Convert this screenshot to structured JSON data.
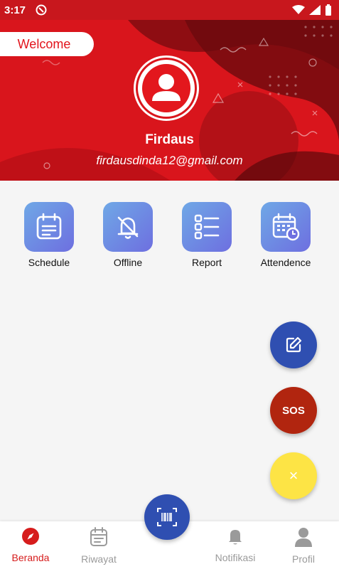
{
  "status": {
    "time": "3:17"
  },
  "profile": {
    "welcome": "Welcome",
    "name": "Firdaus",
    "email": "firdausdinda12@gmail.com"
  },
  "menu": [
    {
      "label": "Schedule",
      "icon": "schedule-icon"
    },
    {
      "label": "Offline",
      "icon": "bell-off-icon"
    },
    {
      "label": "Report",
      "icon": "checklist-icon"
    },
    {
      "label": "Attendence",
      "icon": "calendar-clock-icon"
    }
  ],
  "fabs": {
    "sos_label": "SOS",
    "close_symbol": "×"
  },
  "bottom_nav": [
    {
      "label": "Beranda",
      "icon": "compass-icon",
      "active": true
    },
    {
      "label": "Riwayat",
      "icon": "calendar-icon",
      "active": false
    },
    {
      "label": "Notifikasi",
      "icon": "bell-icon",
      "active": false
    },
    {
      "label": "Profil",
      "icon": "person-icon",
      "active": false
    }
  ],
  "colors": {
    "primary_red": "#d7141b",
    "fab_blue": "#2f4fb1",
    "sos_red": "#b1250f",
    "fab_yellow": "#fde445"
  }
}
